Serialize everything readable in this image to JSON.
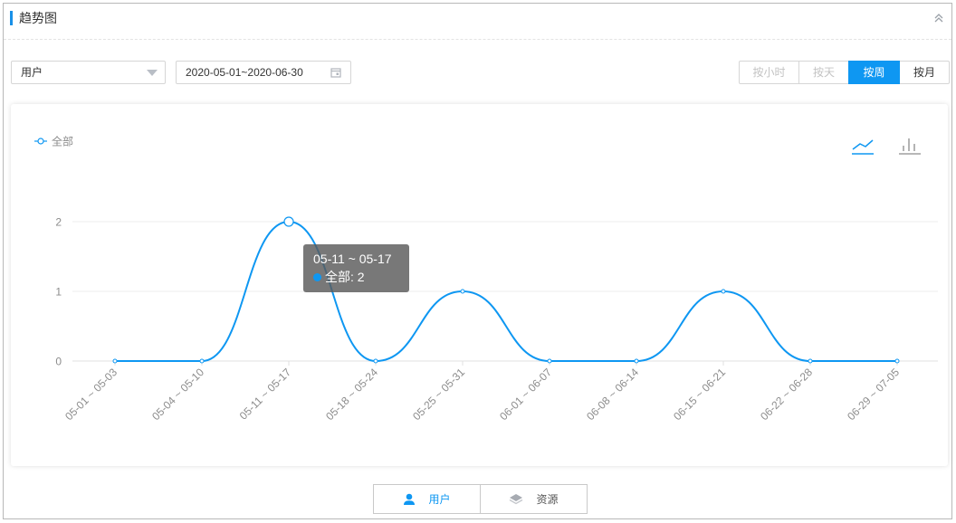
{
  "header": {
    "title": "趋势图"
  },
  "filters": {
    "dimension_value": "用户",
    "date_range": "2020-05-01~2020-06-30"
  },
  "granularity": {
    "options": [
      {
        "label": "按小时",
        "state": "disabled"
      },
      {
        "label": "按天",
        "state": "disabled"
      },
      {
        "label": "按周",
        "state": "active"
      },
      {
        "label": "按月",
        "state": "normal"
      }
    ]
  },
  "tooltip": {
    "title": "05-11 ~ 05-17",
    "row": "全部: 2"
  },
  "bottom_tabs": [
    {
      "label": "用户",
      "icon": "user-icon",
      "active": true
    },
    {
      "label": "资源",
      "icon": "layers-icon",
      "active": false
    }
  ],
  "colors": {
    "accent": "#0e97f2",
    "grid": "#ececec",
    "axis_text": "#8c8c8c"
  },
  "chart_data": {
    "type": "line",
    "smooth": true,
    "legend": "top-left",
    "grid": true,
    "categories": [
      "05-01 ~ 05-03",
      "05-04 ~ 05-10",
      "05-11 ~ 05-17",
      "05-18 ~ 05-24",
      "05-25 ~ 05-31",
      "06-01 ~ 06-07",
      "06-08 ~ 06-14",
      "06-15 ~ 06-21",
      "06-22 ~ 06-28",
      "06-29 ~ 07-05"
    ],
    "series": [
      {
        "name": "全部",
        "values": [
          0,
          0,
          2,
          0,
          1,
          0,
          0,
          1,
          0,
          0
        ]
      }
    ],
    "yticks": [
      0,
      1,
      2
    ],
    "ylim": [
      0,
      2
    ],
    "highlight_index": 2
  }
}
